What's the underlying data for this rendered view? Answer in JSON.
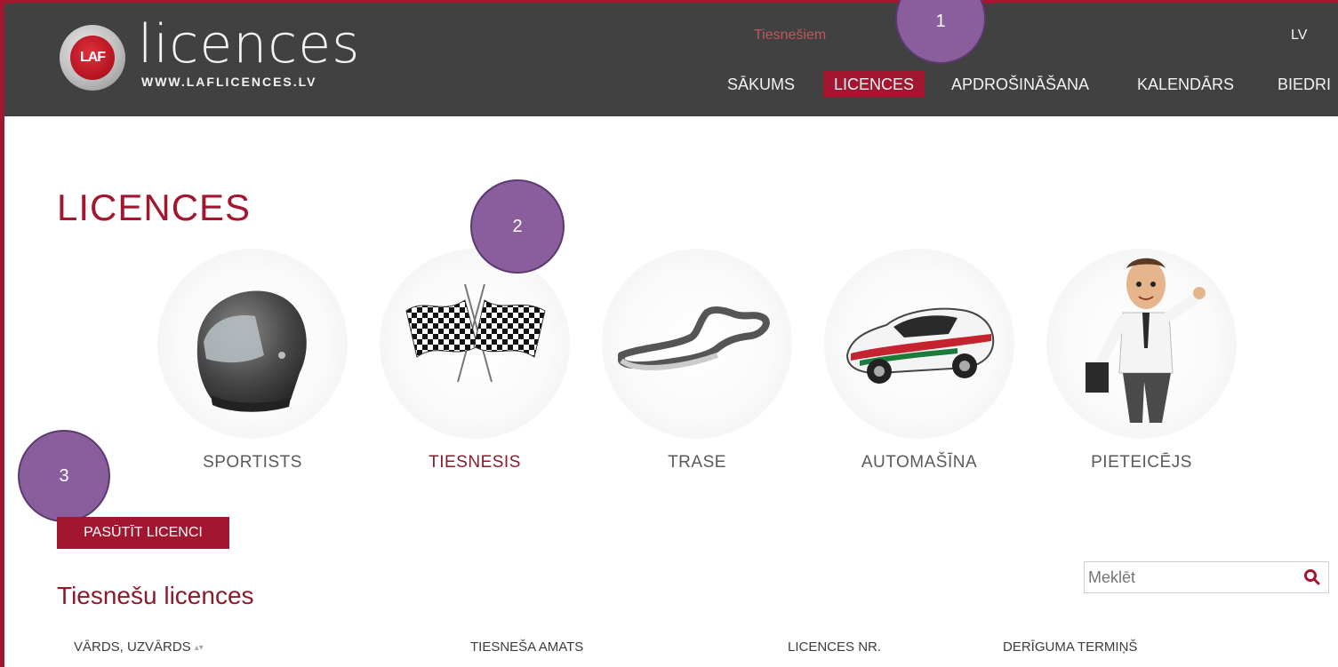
{
  "header": {
    "logo_word": "licences",
    "logo_url": "WWW.LAFLICENCES.LV",
    "logo_mark_text": "LAF",
    "top_link": "Tiesnešiem",
    "lang": "LV",
    "nav": [
      {
        "label": "SĀKUMS",
        "active": false
      },
      {
        "label": "LICENCES",
        "active": true
      },
      {
        "label": "APDROŠINĀŠANA",
        "active": false
      },
      {
        "label": "KALENDĀRS",
        "active": false
      },
      {
        "label": "BIEDRI",
        "active": false
      }
    ]
  },
  "annotations": [
    "1",
    "2",
    "3"
  ],
  "page": {
    "title": "LICENCES"
  },
  "categories": [
    {
      "label": "SPORTISTS",
      "icon": "helmet-icon",
      "active": false
    },
    {
      "label": "TIESNESIS",
      "icon": "checkered-flags-icon",
      "active": true
    },
    {
      "label": "TRASE",
      "icon": "race-track-icon",
      "active": false
    },
    {
      "label": "AUTOMAŠĪNA",
      "icon": "rally-car-icon",
      "active": false
    },
    {
      "label": "PIETEICĒJS",
      "icon": "businessman-icon",
      "active": false
    }
  ],
  "order_button": "PASŪTĪT LICENCI",
  "search": {
    "placeholder": "Meklēt",
    "value": ""
  },
  "section_title": "Tiesnešu licences",
  "table": {
    "columns": [
      "VĀRDS, UZVĀRDS",
      "TIESNEŠA AMATS",
      "LICENCES NR.",
      "DERĪGUMA TERMIŅŠ"
    ]
  },
  "colors": {
    "accent": "#a3162f",
    "header_bg": "#414141",
    "badge": "#8a5e9d"
  }
}
